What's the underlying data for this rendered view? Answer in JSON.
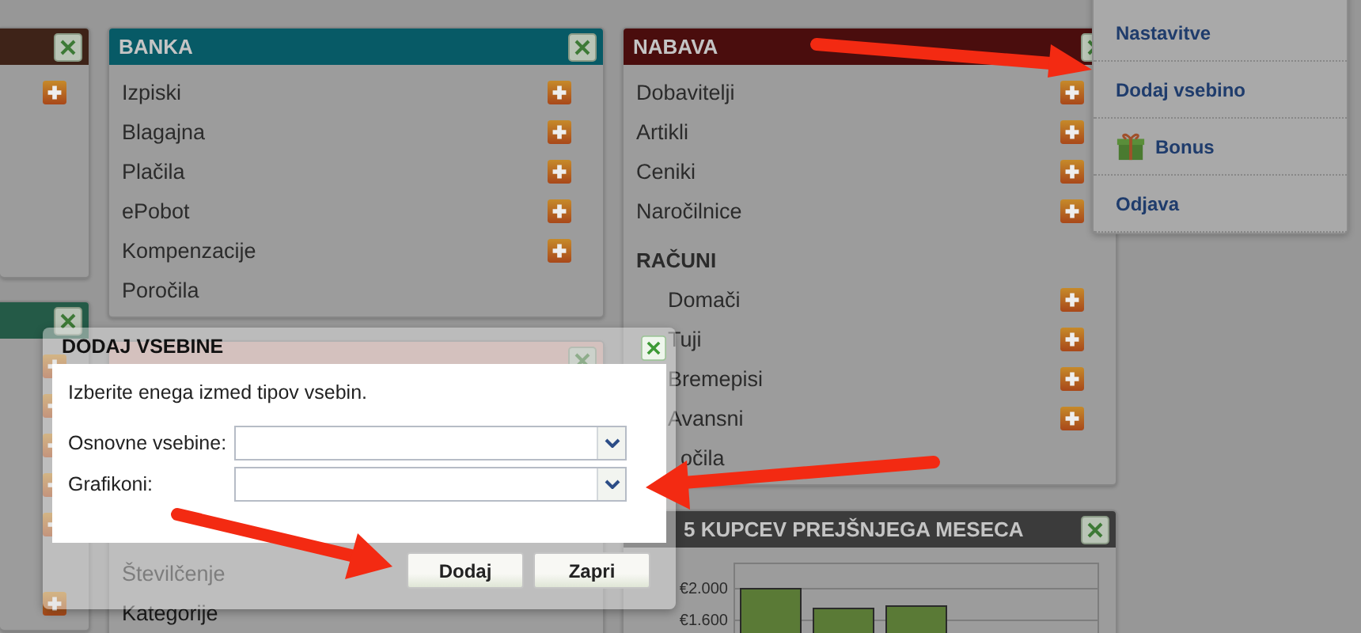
{
  "columns": [
    [
      {
        "color": "#3e2318",
        "items": [
          {
            "add": true
          },
          {
            "add": false
          },
          {
            "add": false
          },
          {
            "add": false
          },
          {
            "add": false
          }
        ]
      },
      {
        "color": "#245a47",
        "items": [
          {
            "add": true
          },
          {
            "add": true
          },
          {
            "add": true
          },
          {
            "add": true
          },
          {
            "add": true
          },
          {
            "add": false
          },
          {
            "add": true
          }
        ]
      }
    ],
    [
      {
        "title": "BANKA",
        "color": "#075a66",
        "items": [
          {
            "label": "Izpiski",
            "add": true
          },
          {
            "label": "Blagajna",
            "add": true
          },
          {
            "label": "Plačila",
            "add": true
          },
          {
            "label": "ePobot",
            "add": true
          },
          {
            "label": "Kompenzacije",
            "add": true
          },
          {
            "label": "Poročila",
            "add": false
          }
        ]
      },
      {
        "items": [
          {
            "label": "Številčenje",
            "add": false
          },
          {
            "label": "Kategorije",
            "add": false
          }
        ]
      }
    ],
    [
      {
        "title": "NABAVA",
        "color": "#4a0d0d",
        "items": [
          {
            "label": "Dobavitelji",
            "add": true
          },
          {
            "label": "Artikli",
            "add": true
          },
          {
            "label": "Ceniki",
            "add": true
          },
          {
            "label": "Naročilnice",
            "add": true
          },
          {
            "label": "RAČUNI",
            "kind": "group",
            "children": [
              {
                "label": "Domači",
                "add": true
              },
              {
                "label": "Tuji",
                "add": true
              },
              {
                "label": "Bremepisi",
                "add": true
              },
              {
                "label": "Avansni",
                "add": true
              }
            ]
          },
          {
            "label": "očila",
            "kind": "partial",
            "add": false
          }
        ]
      },
      {
        "title": "5 KUPCEV PREJŠNJEGA MESECA",
        "color": "#3b3b3b",
        "chart_data": {
          "type": "bar",
          "values": [
            2000,
            1750,
            1780,
            null,
            null
          ],
          "ylim": [
            1400,
            2320
          ],
          "yticks": [
            {
              "value": 1600,
              "label": "€1.600"
            },
            {
              "value": 2000,
              "label": "€2.000"
            }
          ]
        }
      }
    ]
  ],
  "menu": [
    {
      "label": "Nastavitve"
    },
    {
      "label": "Dodaj vsebino"
    },
    {
      "label": "Bonus",
      "kind": "gift"
    },
    {
      "label": "Odjava"
    }
  ],
  "dialog": {
    "title": "DODAJ VSEBINE",
    "text": "Izberite enega izmed tipov vsebin.",
    "fields": [
      {
        "label": "Osnovne vsebine:"
      },
      {
        "label": "Grafikoni:"
      }
    ],
    "buttons": [
      "Dodaj",
      "Zapri"
    ]
  }
}
